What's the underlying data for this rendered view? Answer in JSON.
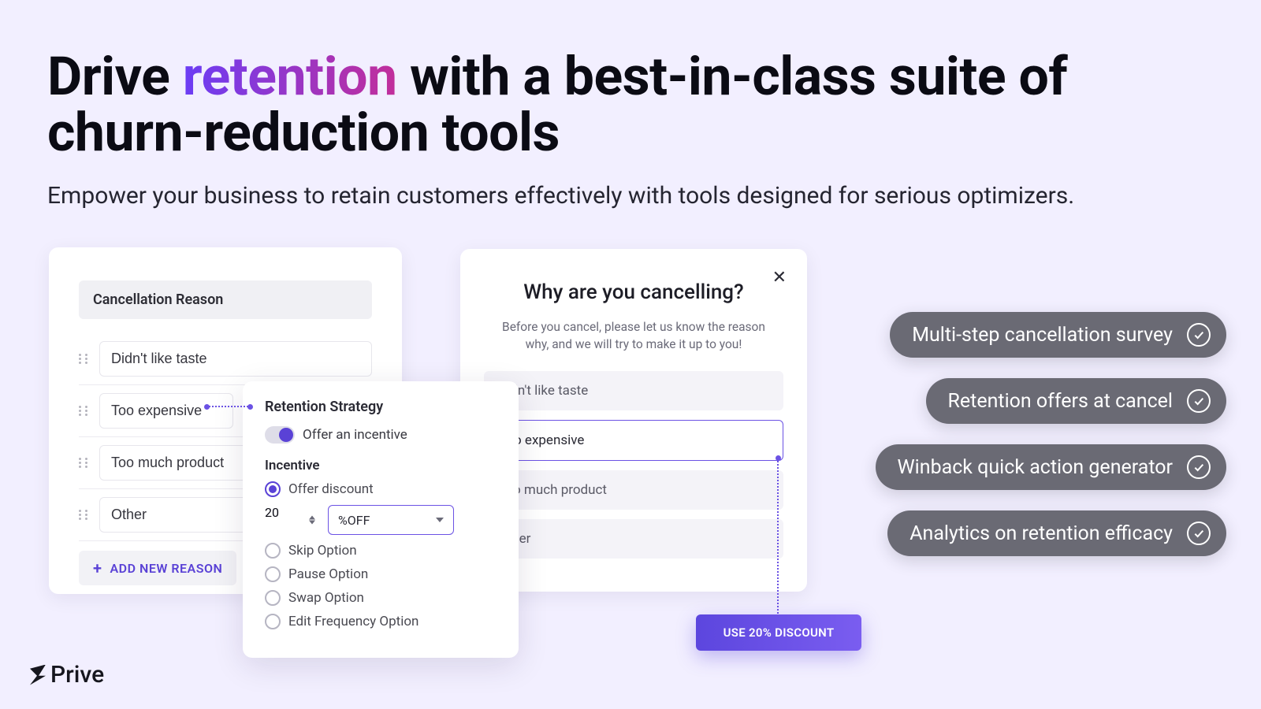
{
  "hero": {
    "title_pre": "Drive ",
    "title_highlight": "retention",
    "title_post": " with a best-in-class suite of churn-reduction tools",
    "subtitle": "Empower your business to retain customers effectively with tools designed for serious optimizers."
  },
  "reasons_card": {
    "header": "Cancellation Reason",
    "items": [
      "Didn't like taste",
      "Too expensive",
      "Too much product",
      "Other"
    ],
    "add_label": "ADD NEW REASON"
  },
  "strategy_card": {
    "title": "Retention Strategy",
    "toggle_label": "Offer an incentive",
    "incentive_label": "Incentive",
    "offer_discount_label": "Offer discount",
    "discount_value": "20",
    "discount_unit": "%OFF",
    "options": [
      "Skip Option",
      "Pause Option",
      "Swap Option",
      "Edit Frequency Option"
    ]
  },
  "cancel_card": {
    "title": "Why are you cancelling?",
    "subtitle": "Before you cancel, please let us know the reason why, and we will try to make it up to you!",
    "options": [
      "Didn't like taste",
      "Too expensive",
      "Too much product",
      "Other"
    ],
    "selected_index": 1
  },
  "cta": {
    "label": "USE 20% DISCOUNT"
  },
  "pills": [
    "Multi-step cancellation survey",
    "Retention offers at cancel",
    "Winback quick action generator",
    "Analytics on retention efficacy"
  ],
  "brand": {
    "name": "Prive"
  }
}
